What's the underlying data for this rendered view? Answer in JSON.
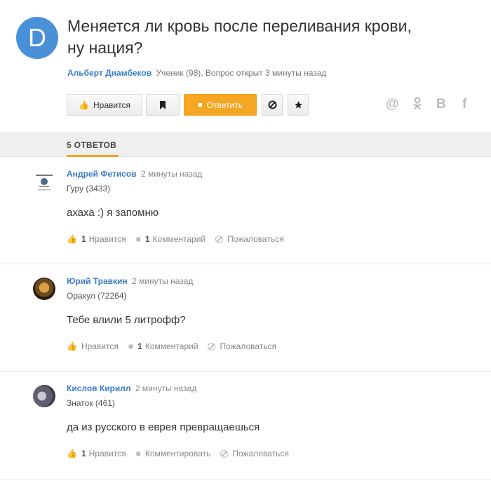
{
  "question": {
    "avatar_letter": "D",
    "avatar_color": "#4a90d9",
    "title_line1": "Меняется ли кровь после переливания крови,",
    "title_line2": "ну нация?",
    "author": "Альберт Диамбеков",
    "meta": "Ученик (98), Вопрос открыт 3 минуты назад"
  },
  "toolbar": {
    "like_label": "Нравится",
    "answer_label": "Ответить"
  },
  "answers_tab": {
    "label": "5 ОТВЕТОВ"
  },
  "answers": [
    {
      "author": "Андрей Фетисов",
      "time": "2 минуты назад",
      "rank": "Гуру (3433)",
      "text": "ахаха :) я запомню",
      "likes": "1",
      "like_label": "Нравится",
      "comments": "1",
      "comment_label": "Комментарий",
      "report_label": "Пожаловаться"
    },
    {
      "author": "Юрий Травкин",
      "time": "2 минуты назад",
      "rank": "Оракул (72264)",
      "text": "Тебе влили 5 литрофф?",
      "like_label": "Нравится",
      "comments": "1",
      "comment_label": "Комментарий",
      "report_label": "Пожаловаться"
    },
    {
      "author": "Кислов Кирилл",
      "time": "2 минуты назад",
      "rank": "Знаток (461)",
      "text": "да из русского в еврея превращаешься",
      "likes": "1",
      "like_label": "Нравится",
      "comment_label": "Комментировать",
      "report_label": "Пожаловаться"
    }
  ],
  "colors": {
    "accent": "#f5a623",
    "link": "#3a7bc8"
  }
}
